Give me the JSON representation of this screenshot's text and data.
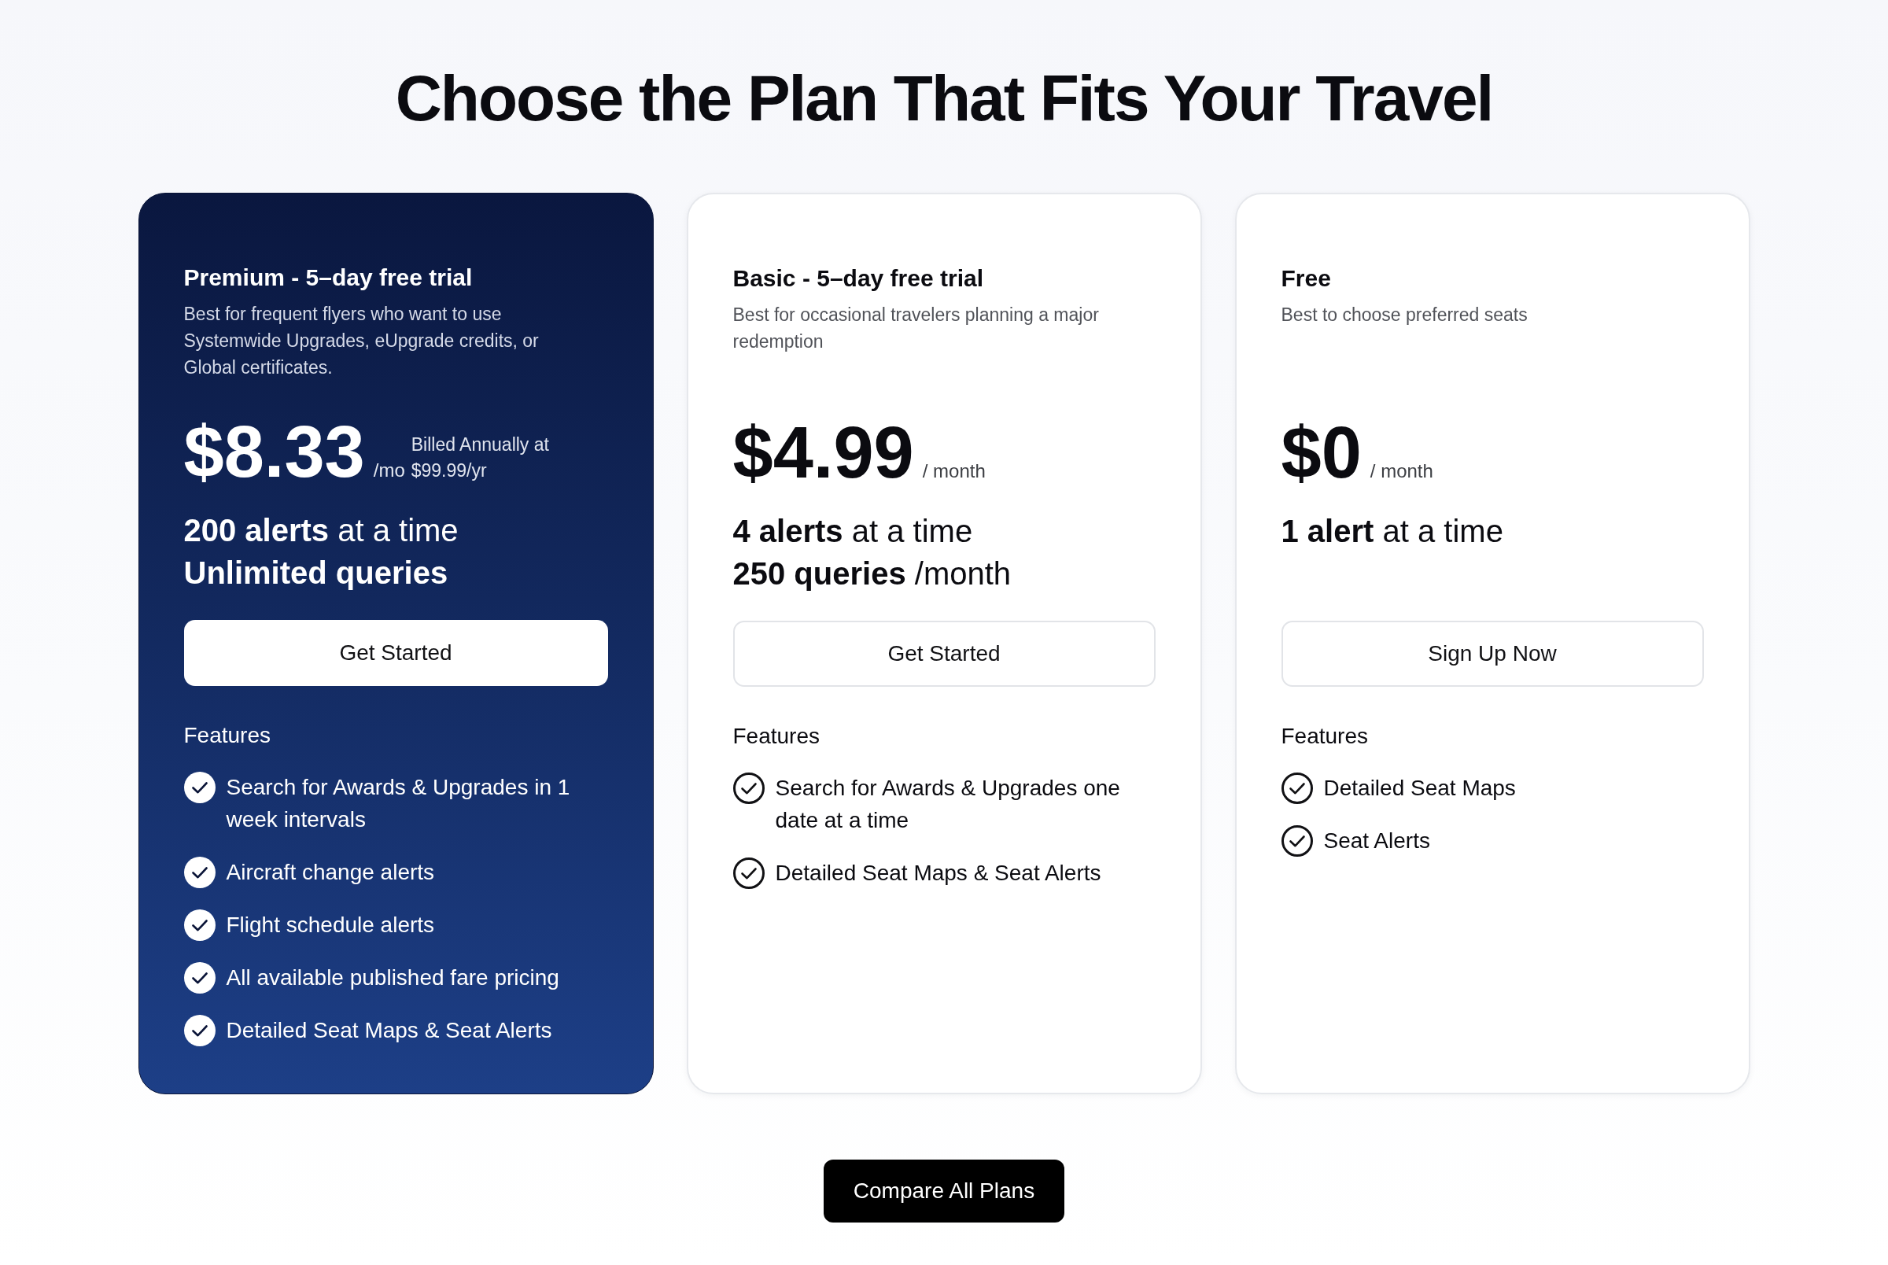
{
  "heading": "Choose the Plan That Fits Your Travel",
  "plans": [
    {
      "highlighted": true,
      "name": "Premium - 5–day free trial",
      "description": "Best for frequent flyers who want to use Systemwide Upgrades, eUpgrade credits, or Global certificates.",
      "price": "$8.33",
      "price_unit": "/mo",
      "billing_note": "Billed Annually at $99.99/yr",
      "limits": [
        {
          "amount": "200 alerts",
          "rest": "at a time"
        },
        {
          "amount": "Unlimited queries"
        }
      ],
      "button": "Get Started",
      "features_label": "Features",
      "features": [
        "Search for Awards & Upgrades in 1 week intervals",
        "Aircraft change alerts",
        "Flight schedule alerts",
        "All available published fare pricing",
        "Detailed Seat Maps & Seat Alerts"
      ]
    },
    {
      "highlighted": false,
      "name": "Basic - 5–day free trial",
      "description": "Best for occasional travelers planning a major redemption",
      "price": "$4.99",
      "price_unit": "/ month",
      "limits": [
        {
          "amount": "4 alerts",
          "rest": "at a time"
        },
        {
          "amount": "250 queries",
          "rest": "/month"
        }
      ],
      "button": "Get Started",
      "features_label": "Features",
      "features": [
        "Search for Awards & Upgrades one date at a time",
        "Detailed Seat Maps & Seat Alerts"
      ]
    },
    {
      "highlighted": false,
      "name": "Free",
      "description": "Best to choose preferred seats",
      "price": "$0",
      "price_unit": "/ month",
      "limits": [
        {
          "amount": "1 alert",
          "rest": "at a time"
        }
      ],
      "button": "Sign Up Now",
      "features_label": "Features",
      "features": [
        "Detailed Seat Maps",
        "Seat Alerts"
      ]
    }
  ],
  "compare_button": "Compare All Plans"
}
